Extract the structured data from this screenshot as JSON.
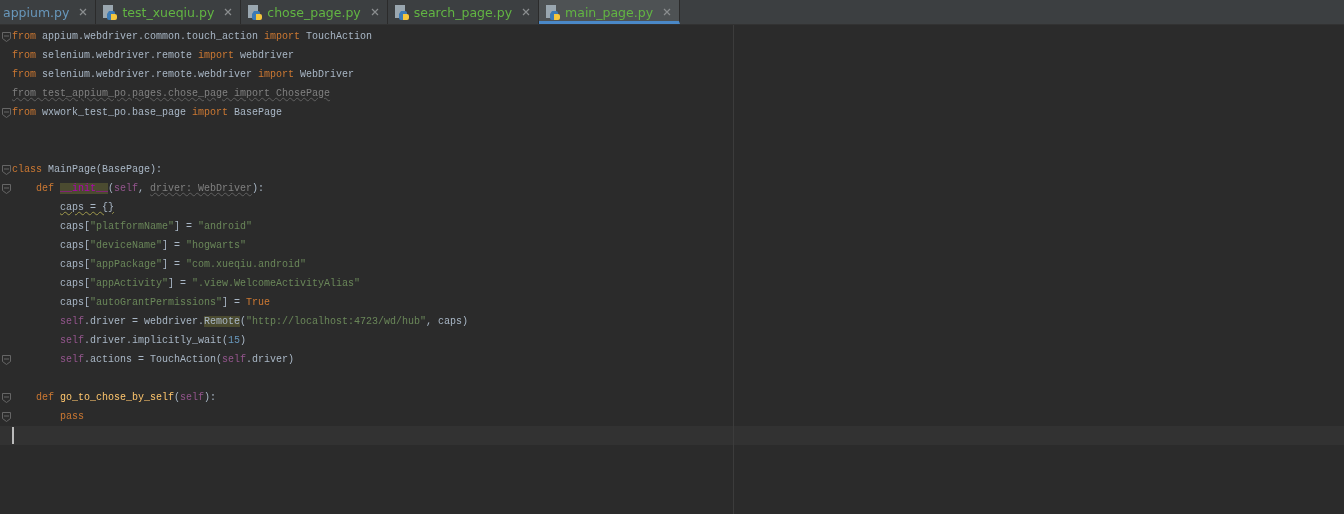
{
  "tabs": [
    {
      "label": "appium.py",
      "selected": false,
      "icon": false,
      "color": "#6897bb"
    },
    {
      "label": "test_xueqiu.py",
      "selected": false,
      "icon": true,
      "color": "#62b543"
    },
    {
      "label": "chose_page.py",
      "selected": false,
      "icon": true,
      "color": "#62b543"
    },
    {
      "label": "search_page.py",
      "selected": false,
      "icon": true,
      "color": "#62b543"
    },
    {
      "label": "main_page.py",
      "selected": true,
      "icon": true,
      "color": "#62b543"
    }
  ],
  "editor": {
    "lines": [
      {
        "fold": true,
        "tokens": [
          {
            "kind": "keyword",
            "text": "from"
          },
          {
            "kind": "plain",
            "text": " appium.webdriver.common.touch_action "
          },
          {
            "kind": "keyword",
            "text": "import"
          },
          {
            "kind": "plain",
            "text": " TouchAction"
          }
        ]
      },
      {
        "fold": false,
        "tokens": [
          {
            "kind": "keyword",
            "text": "from"
          },
          {
            "kind": "plain",
            "text": " selenium.webdriver.remote "
          },
          {
            "kind": "keyword",
            "text": "import"
          },
          {
            "kind": "plain",
            "text": " webdriver"
          }
        ]
      },
      {
        "fold": false,
        "tokens": [
          {
            "kind": "keyword",
            "text": "from"
          },
          {
            "kind": "plain",
            "text": " selenium.webdriver.remote.webdriver "
          },
          {
            "kind": "keyword",
            "text": "import"
          },
          {
            "kind": "plain",
            "text": " WebDriver"
          }
        ]
      },
      {
        "fold": false,
        "tokens": [
          {
            "kind": "unused",
            "text": "from test_appium_po.pages.chose_page import ChosePage"
          }
        ]
      },
      {
        "fold": true,
        "tokens": [
          {
            "kind": "keyword",
            "text": "from"
          },
          {
            "kind": "plain",
            "text": " wxwork_test_po.base_page "
          },
          {
            "kind": "keyword",
            "text": "import"
          },
          {
            "kind": "plain",
            "text": " BasePage"
          }
        ]
      },
      {
        "fold": false
      },
      {
        "fold": false
      },
      {
        "fold": true,
        "tokens": [
          {
            "kind": "keyword",
            "text": "class"
          },
          {
            "kind": "plain",
            "text": " MainPage(BasePage):"
          }
        ],
        "children": [
          {
            "fold": true,
            "tokens": [
              {
                "kind": "keyword",
                "text": "def"
              },
              {
                "kind": "magic",
                "text": "__init__"
              },
              {
                "kind": "plain",
                "text": "("
              },
              {
                "kind": "self",
                "text": "self"
              },
              {
                "kind": "plain",
                "text": ", "
              },
              {
                "kind": "param",
                "text": "driver: WebDriver"
              },
              {
                "kind": "plain",
                "text": "):"
              }
            ],
            "children": [
              {
                "fold": false,
                "tokens": [
                  {
                    "kind": "weak",
                    "text": "caps = {}"
                  }
                ]
              },
              {
                "fold": false,
                "tokens": [
                  {
                    "kind": "plain",
                    "text": "caps["
                  },
                  {
                    "kind": "string",
                    "text": "\"platformName\""
                  },
                  {
                    "kind": "plain",
                    "text": "] = "
                  },
                  {
                    "kind": "string",
                    "text": "\"android\""
                  }
                ]
              },
              {
                "fold": false,
                "tokens": [
                  {
                    "kind": "plain",
                    "text": "caps["
                  },
                  {
                    "kind": "string",
                    "text": "\"deviceName\""
                  },
                  {
                    "kind": "plain",
                    "text": "] = "
                  },
                  {
                    "kind": "string",
                    "text": "\"hogwarts\""
                  }
                ]
              },
              {
                "fold": false,
                "tokens": [
                  {
                    "kind": "plain",
                    "text": "caps["
                  },
                  {
                    "kind": "string",
                    "text": "\"appPackage\""
                  },
                  {
                    "kind": "plain",
                    "text": "] = "
                  },
                  {
                    "kind": "string",
                    "text": "\"com.xueqiu.android\""
                  }
                ]
              },
              {
                "fold": false,
                "tokens": [
                  {
                    "kind": "plain",
                    "text": "caps["
                  },
                  {
                    "kind": "string",
                    "text": "\"appActivity\""
                  },
                  {
                    "kind": "plain",
                    "text": "] = "
                  },
                  {
                    "kind": "string",
                    "text": "\".view.WelcomeActivityAlias\""
                  }
                ]
              },
              {
                "fold": false,
                "tokens": [
                  {
                    "kind": "plain",
                    "text": "caps["
                  },
                  {
                    "kind": "string",
                    "text": "\"autoGrantPermissions\""
                  },
                  {
                    "kind": "plain",
                    "text": "] = "
                  },
                  {
                    "kind": "keyword",
                    "text": "True"
                  }
                ]
              },
              {
                "fold": false,
                "tokens": [
                  {
                    "kind": "self",
                    "text": "self"
                  },
                  {
                    "kind": "plain",
                    "text": ".driver = webdriver."
                  },
                  {
                    "kind": "usage",
                    "text": "Remote"
                  },
                  {
                    "kind": "plain",
                    "text": "("
                  },
                  {
                    "kind": "string",
                    "text": "\"http://localhost:4723/wd/hub\""
                  },
                  {
                    "kind": "plain",
                    "text": ", caps)"
                  }
                ]
              },
              {
                "fold": false,
                "tokens": [
                  {
                    "kind": "self",
                    "text": "self"
                  },
                  {
                    "kind": "plain",
                    "text": ".driver.implicitly_wait("
                  },
                  {
                    "kind": "number",
                    "text": "15"
                  },
                  {
                    "kind": "plain",
                    "text": ")"
                  }
                ]
              },
              {
                "fold": true,
                "tokens": [
                  {
                    "kind": "self",
                    "text": "self"
                  },
                  {
                    "kind": "plain",
                    "text": ".actions = TouchAction("
                  },
                  {
                    "kind": "self",
                    "text": "self"
                  },
                  {
                    "kind": "plain",
                    "text": ".driver)"
                  }
                ]
              }
            ]
          },
          {
            "fold": false
          },
          {
            "fold": true,
            "tokens": [
              {
                "kind": "keyword",
                "text": "def"
              },
              {
                "kind": "funcname",
                "text": "go_to_chose_by_self"
              },
              {
                "kind": "plain",
                "text": "("
              },
              {
                "kind": "self",
                "text": "self"
              },
              {
                "kind": "plain",
                "text": "):"
              }
            ],
            "children": [
              {
                "fold": true,
                "tokens": [
                  {
                    "kind": "keyword",
                    "text": "pass"
                  }
                ]
              }
            ]
          }
        ]
      },
      {
        "fold": false,
        "current": true
      }
    ]
  }
}
